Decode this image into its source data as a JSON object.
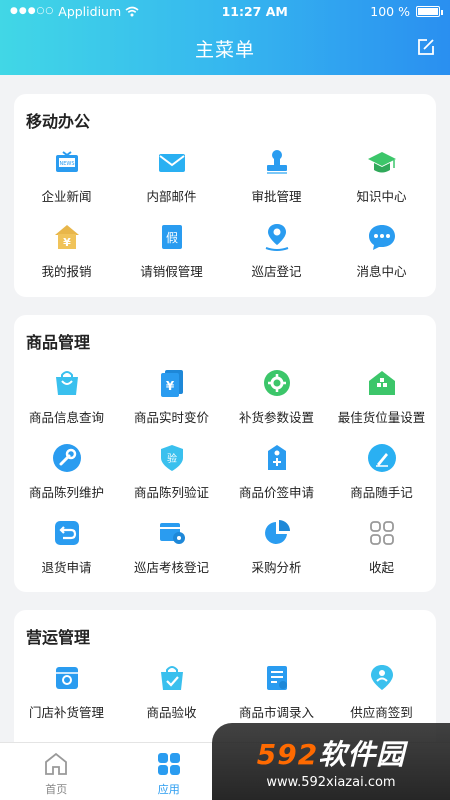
{
  "status_bar": {
    "carrier": "Applidium",
    "time": "11:27 AM",
    "battery": "100 %",
    "battery_level": 1.0
  },
  "header": {
    "title": "主菜单"
  },
  "sections": [
    {
      "title": "移动办公",
      "items": [
        {
          "label": "企业新闻",
          "icon": "news-tv-icon"
        },
        {
          "label": "内部邮件",
          "icon": "mail-icon"
        },
        {
          "label": "审批管理",
          "icon": "stamp-icon"
        },
        {
          "label": "知识中心",
          "icon": "graduation-cap-icon"
        },
        {
          "label": "我的报销",
          "icon": "yen-house-icon"
        },
        {
          "label": "请销假管理",
          "icon": "leave-icon"
        },
        {
          "label": "巡店登记",
          "icon": "location-pin-icon"
        },
        {
          "label": "消息中心",
          "icon": "chat-bubble-icon"
        }
      ]
    },
    {
      "title": "商品管理",
      "items": [
        {
          "label": "商品信息查询",
          "icon": "shopping-bag-icon"
        },
        {
          "label": "商品实时变价",
          "icon": "price-tag-icon"
        },
        {
          "label": "补货参数设置",
          "icon": "settings-icon"
        },
        {
          "label": "最佳货位量设置",
          "icon": "shelf-icon"
        },
        {
          "label": "商品陈列维护",
          "icon": "wrench-icon"
        },
        {
          "label": "商品陈列验证",
          "icon": "verify-shield-icon"
        },
        {
          "label": "商品价签申请",
          "icon": "tag-apply-icon"
        },
        {
          "label": "商品随手记",
          "icon": "pen-icon"
        },
        {
          "label": "退货申请",
          "icon": "return-icon"
        },
        {
          "label": "巡店考核登记",
          "icon": "store-check-icon"
        },
        {
          "label": "采购分析",
          "icon": "pie-chart-icon"
        },
        {
          "label": "收起",
          "icon": "collapse-grid-icon"
        }
      ]
    },
    {
      "title": "营运管理",
      "items": [
        {
          "label": "门店补货管理",
          "icon": "restock-box-icon"
        },
        {
          "label": "商品验收",
          "icon": "acceptance-bag-icon"
        },
        {
          "label": "商品市调录入",
          "icon": "survey-doc-icon"
        },
        {
          "label": "供应商签到",
          "icon": "supplier-pin-icon"
        }
      ]
    }
  ],
  "tabbar": {
    "tabs": [
      {
        "label": "首页",
        "active": false
      },
      {
        "label": "应用",
        "active": true
      }
    ]
  },
  "watermark": {
    "brand_num": "592",
    "brand_cn": "软件园",
    "url": "www.592xiazai.com"
  },
  "colors": {
    "accent": "#2a9cf0",
    "gradient_start": "#41d7e6",
    "gradient_end": "#2a8ff0"
  }
}
